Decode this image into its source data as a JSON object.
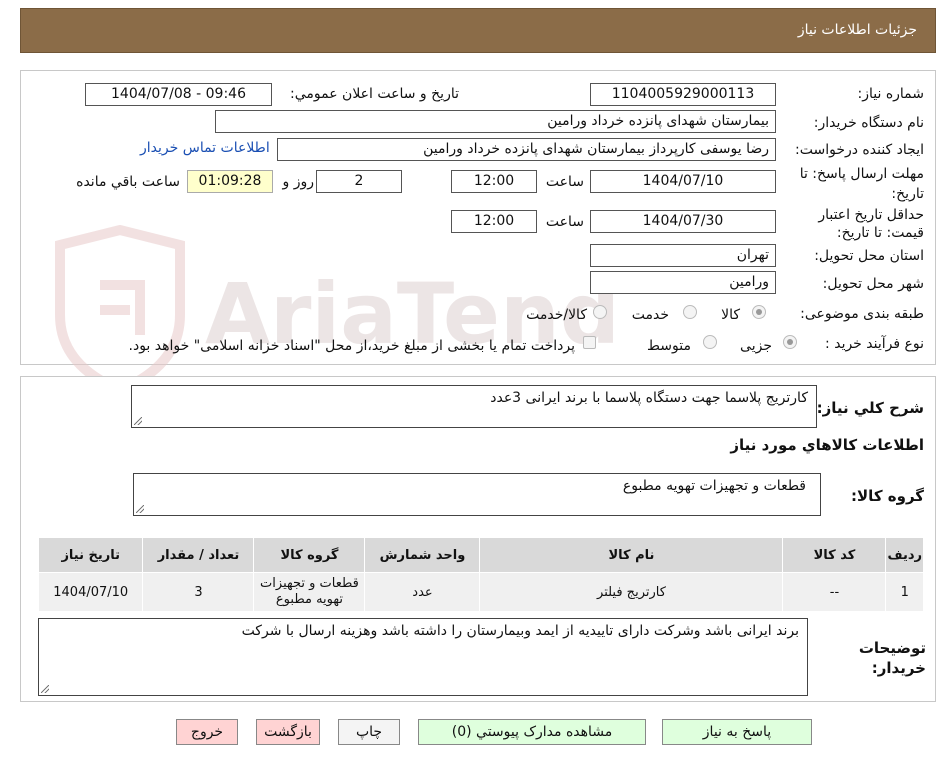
{
  "header": {
    "title": "جزئیات اطلاعات نیاز"
  },
  "form": {
    "need_number_label": "شماره نیاز:",
    "need_number": "1104005929000113",
    "announce_label": "تاریخ و ساعت اعلان عمومي:",
    "announce_value": "1404/07/08 - 09:46",
    "buyer_org_label": "نام دستگاه خريدار:",
    "buyer_org": "بیمارستان شهدای پانزده خرداد ورامین",
    "creator_label": "ايجاد کننده درخواست:",
    "creator": "رضا یوسفی کارپرداز بیمارستان شهدای پانزده خرداد ورامین",
    "contact_link": "اطلاعات تماس خریدار",
    "deadline_label": "مهلت ارسال پاسخ: تا تاريخ:",
    "deadline_date": "1404/07/10",
    "time_label": "ساعت",
    "deadline_time": "12:00",
    "days": "2",
    "days_label": "روز و",
    "remaining_time": "01:09:28",
    "remaining_label": "ساعت باقي مانده",
    "validity_label": "حداقل تاريخ اعتبار قيمت: تا تاريخ:",
    "validity_date": "1404/07/30",
    "validity_time": "12:00",
    "province_label": "استان محل تحويل:",
    "province": "تهران",
    "city_label": "شهر محل تحويل:",
    "city": "ورامین",
    "category_label": "طبقه بندی موضوعی:",
    "category_options": [
      "کالا",
      "خدمت",
      "کالا/خدمت"
    ],
    "process_label": "نوع فرآیند خرید :",
    "process_options": [
      "جزیی",
      "متوسط"
    ],
    "payment_note": "پرداخت تمام یا بخشی از مبلغ خرید،از محل \"اسناد خزانه اسلامی\" خواهد بود."
  },
  "details": {
    "summary_label": "شرح کلي نياز:",
    "summary": "کارتریج پلاسما جهت دستگاه پلاسما با برند ایرانی 3عدد",
    "goods_info_title": "اطلاعات کالاهاي مورد نياز",
    "goods_group_label": "گروه کالا:",
    "goods_group": "قطعات و تجهیزات تهویه مطبوع"
  },
  "table": {
    "headers": [
      "رديف",
      "کد کالا",
      "نام کالا",
      "واحد شمارش",
      "گروه کالا",
      "تعداد / مقدار",
      "تاریخ نیاز"
    ],
    "rows": [
      [
        "1",
        "--",
        "کارتریج فیلتر",
        "عدد",
        "قطعات و تجهیزات تهویه مطبوع",
        "3",
        "1404/07/10"
      ]
    ]
  },
  "buyer_notes": {
    "label": "توضيحات خريدار:",
    "text": "برند ایرانی باشد وشرکت دارای تاییدیه از ایمد وبیمارستان را داشته باشد وهزینه ارسال با شرکت"
  },
  "buttons": {
    "reply": "پاسخ به نياز",
    "attachments": "مشاهده مدارک پيوستي (0)",
    "print": "چاپ",
    "back": "بازگشت",
    "exit": "خروج"
  },
  "watermark": "AriaTender.neT",
  "colors": {
    "header_bg": "#8b6c48",
    "link": "#1a4fb3",
    "timer_bg": "#ffffcc",
    "green_btn": "#dfffdd",
    "pink_btn": "#ffd3d3"
  }
}
